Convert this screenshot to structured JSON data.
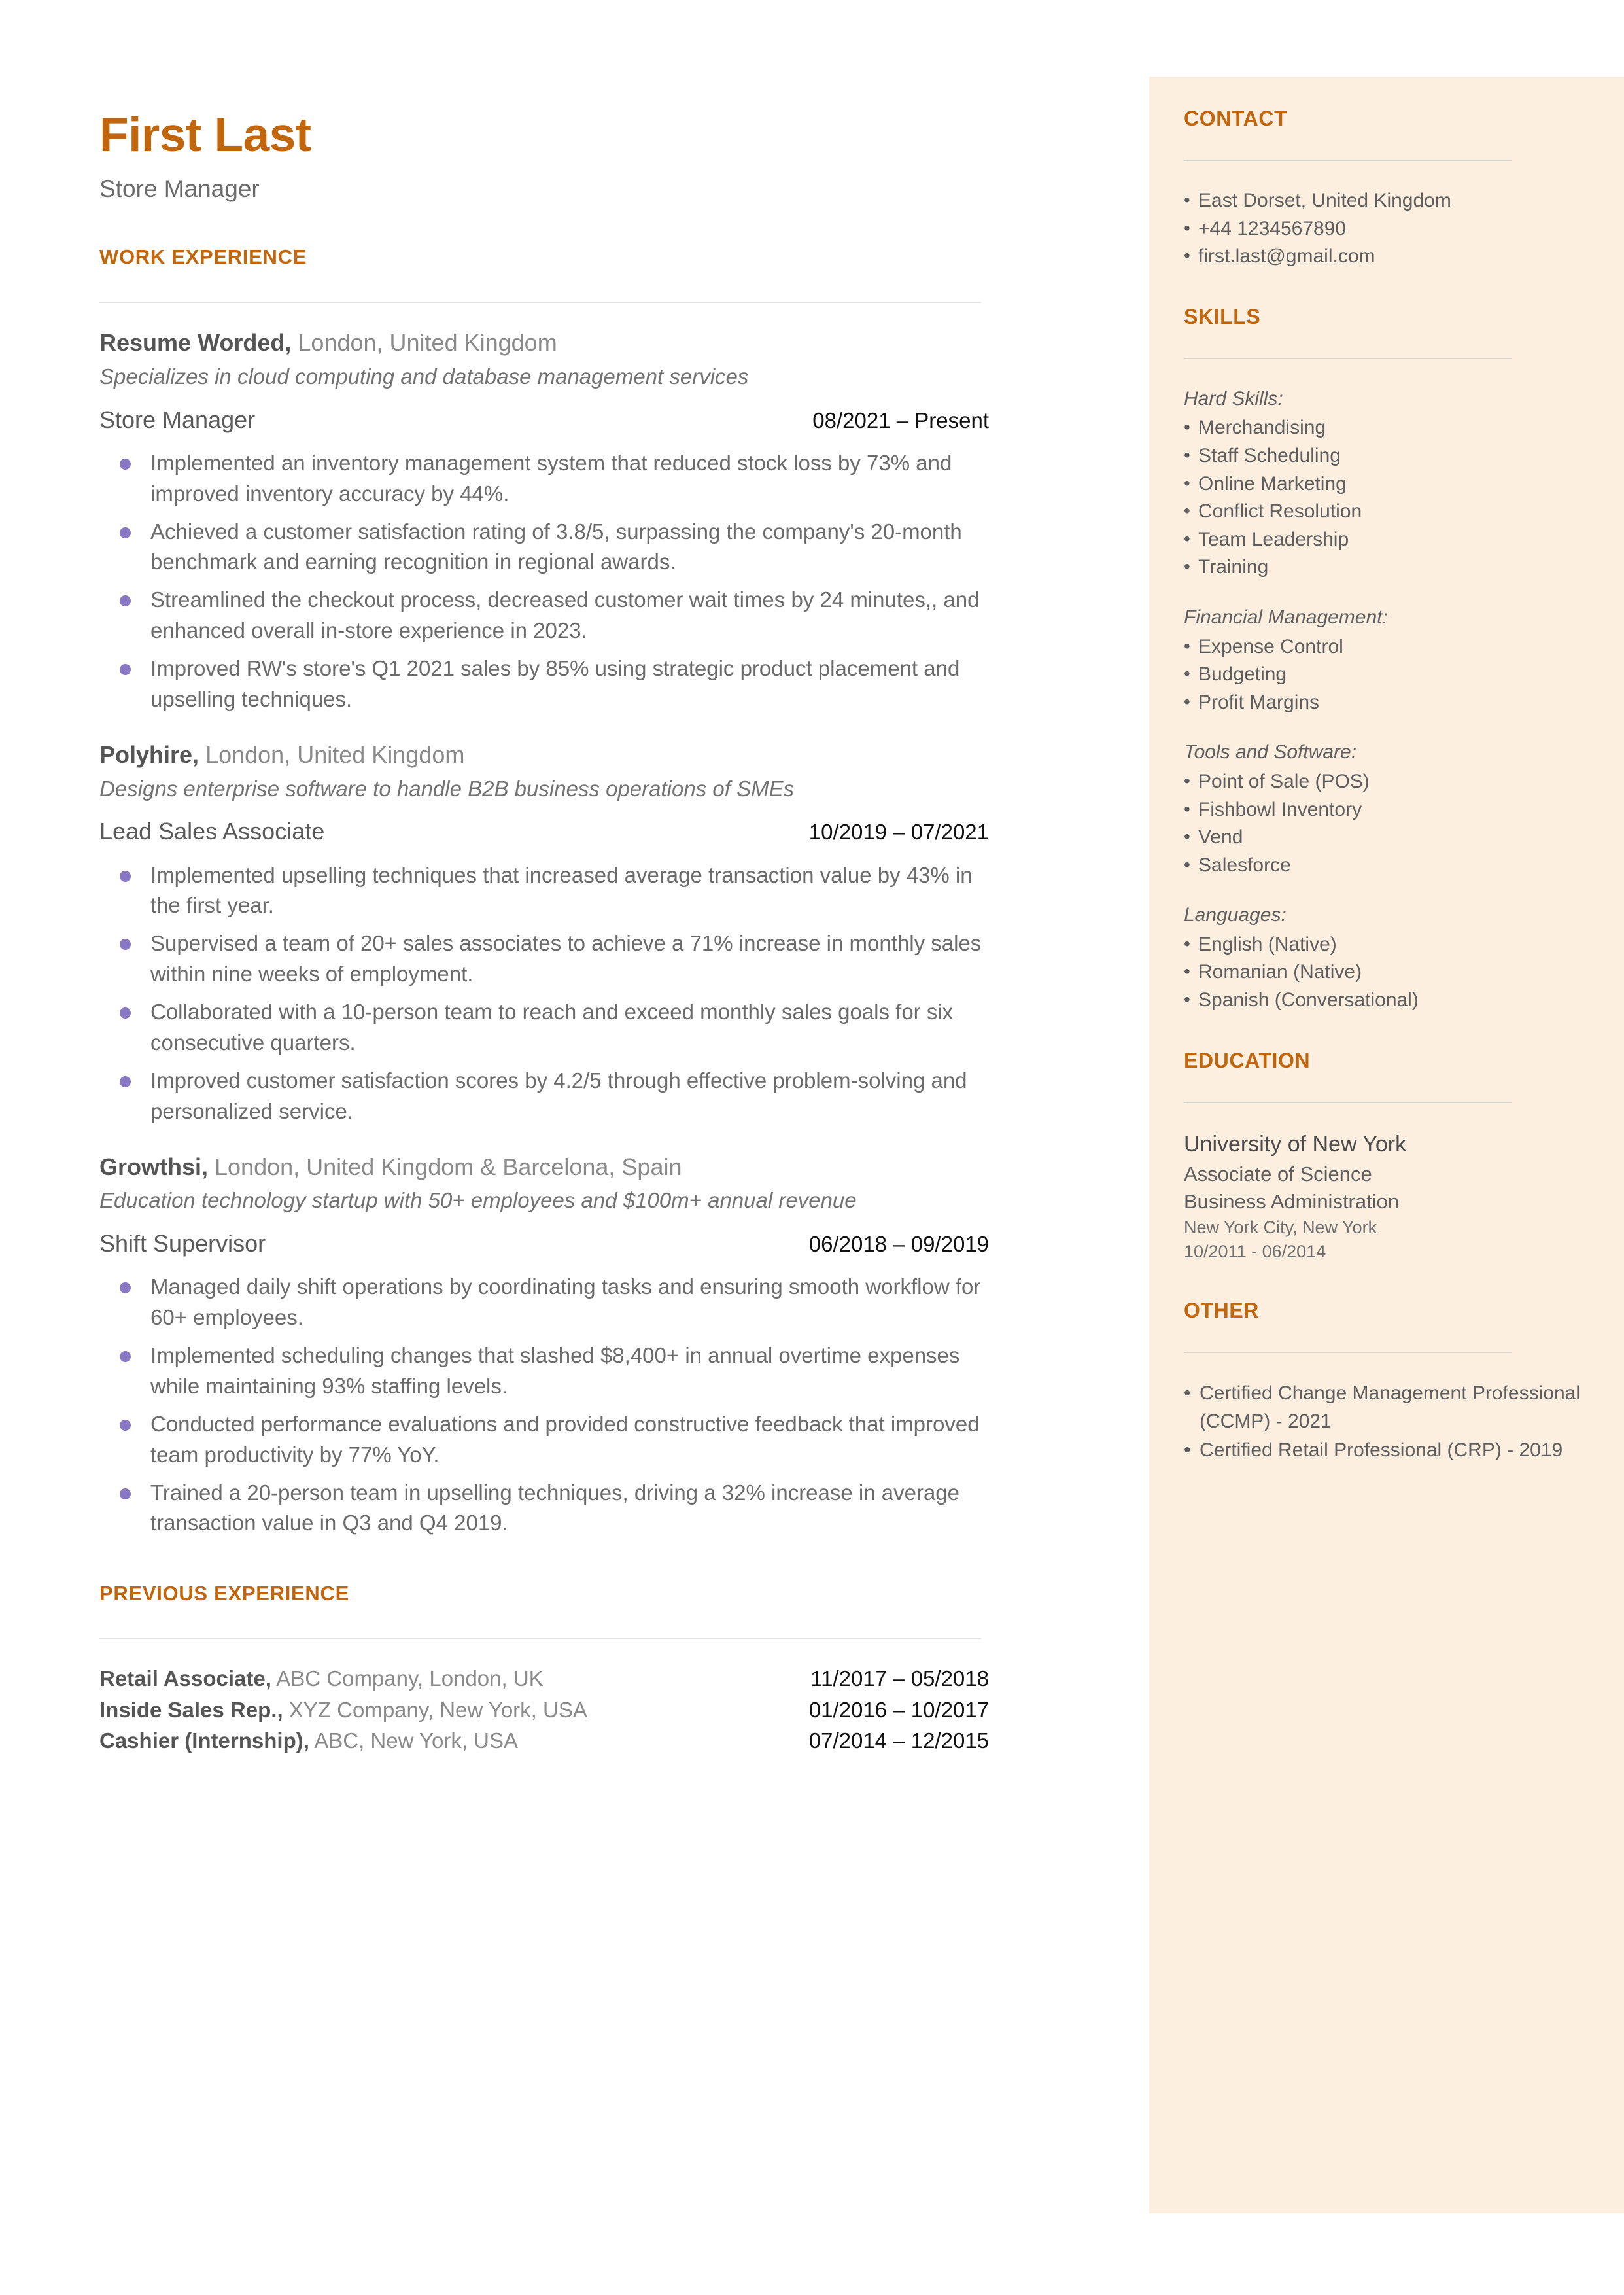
{
  "colors": {
    "accent": "#C1660C",
    "sidebar_bg": "#FDEFE0",
    "bullet": "#8878C3",
    "body_text": "#6B6B6B",
    "date_text": "#111111"
  },
  "header": {
    "name": "First Last",
    "role": "Store Manager"
  },
  "sections": {
    "work_experience": "WORK EXPERIENCE",
    "previous_experience": "PREVIOUS EXPERIENCE",
    "contact": "CONTACT",
    "skills": "SKILLS",
    "education": "EDUCATION",
    "other": "OTHER"
  },
  "jobs": [
    {
      "company": "Resume Worded,",
      "location": "London, United Kingdom",
      "tagline": "Specializes in cloud computing and database management services",
      "title": "Store Manager",
      "date": "08/2021 – Present",
      "bullets": [
        "Implemented an inventory management system that reduced stock loss by 73% and improved inventory accuracy by 44%.",
        "Achieved a customer satisfaction rating of 3.8/5, surpassing the company's 20-month benchmark and earning recognition in regional awards.",
        "Streamlined the checkout process, decreased customer wait times by 24 minutes,, and enhanced overall in-store experience in 2023.",
        "Improved RW's store's Q1 2021 sales by 85% using strategic product placement and upselling techniques."
      ]
    },
    {
      "company": "Polyhire,",
      "location": "London, United Kingdom",
      "tagline": "Designs enterprise software to handle B2B business operations of SMEs",
      "title": "Lead Sales Associate",
      "date": "10/2019 – 07/2021",
      "bullets": [
        "Implemented upselling techniques that increased average transaction value by 43% in the first year.",
        "Supervised a team of 20+ sales associates to achieve a 71% increase in monthly sales within nine weeks of employment.",
        "Collaborated with a 10-person team to reach and exceed monthly sales goals for six consecutive quarters.",
        "Improved customer satisfaction scores by 4.2/5 through effective problem-solving and personalized service."
      ]
    },
    {
      "company": "Growthsi,",
      "location": "London, United Kingdom & Barcelona, Spain",
      "tagline": "Education technology startup with 50+ employees and $100m+ annual revenue",
      "title": "Shift Supervisor",
      "date": "06/2018 – 09/2019",
      "bullets": [
        "Managed daily shift operations by coordinating tasks and ensuring smooth workflow for 60+ employees.",
        "Implemented scheduling changes that slashed $8,400+ in annual overtime expenses while maintaining 93% staffing levels.",
        "Conducted performance evaluations and provided constructive feedback that improved team productivity by 77% YoY.",
        "Trained a 20-person team in upselling techniques, driving a 32% increase in average transaction value in Q3 and Q4 2019."
      ]
    }
  ],
  "previous_jobs": [
    {
      "title": "Retail Associate,",
      "detail": "ABC Company, London, UK",
      "date": "11/2017 – 05/2018"
    },
    {
      "title": "Inside Sales Rep.,",
      "detail": "XYZ Company, New York, USA",
      "date": "01/2016 – 10/2017"
    },
    {
      "title": "Cashier (Internship),",
      "detail": "ABC, New York, USA",
      "date": "07/2014 – 12/2015"
    }
  ],
  "contact": [
    "East Dorset, United Kingdom",
    "+44 1234567890",
    "first.last@gmail.com"
  ],
  "skill_groups": [
    {
      "label": "Hard Skills:",
      "items": [
        "Merchandising",
        "Staff Scheduling",
        "Online Marketing",
        "Conflict Resolution",
        "Team Leadership",
        "Training"
      ]
    },
    {
      "label": "Financial Management:",
      "items": [
        "Expense Control",
        "Budgeting",
        "Profit Margins"
      ]
    },
    {
      "label": "Tools and Software:",
      "items": [
        "Point of Sale (POS)",
        "Fishbowl Inventory",
        "Vend",
        "Salesforce"
      ]
    },
    {
      "label": "Languages:",
      "items": [
        "English (Native)",
        "Romanian (Native)",
        "Spanish (Conversational)"
      ]
    }
  ],
  "education": {
    "school": "University of New York",
    "degree": "Associate of Science",
    "field": "Business Administration",
    "location": "New York City, New York",
    "dates": "10/2011 - 06/2014"
  },
  "other": [
    "Certified Change Management Professional (CCMP) - 2021",
    "Certified Retail Professional (CRP) - 2019"
  ]
}
